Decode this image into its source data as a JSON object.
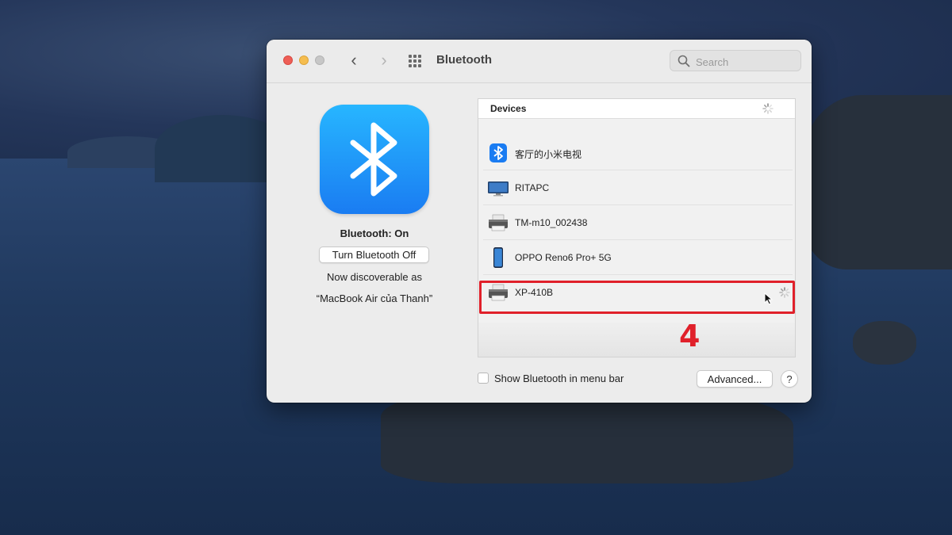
{
  "window": {
    "title": "Bluetooth",
    "search": {
      "placeholder": "Search",
      "value": ""
    }
  },
  "bluetooth": {
    "status": "Bluetooth: On",
    "toggle_label": "Turn Bluetooth Off",
    "discoverable_line1": "Now discoverable as",
    "discoverable_line2": "“MacBook Air của Thanh”"
  },
  "devices": {
    "header": "Devices",
    "items": [
      {
        "name": "客厅的小米电视",
        "icon": "bluetooth-device-icon"
      },
      {
        "name": "RITAPC",
        "icon": "desktop-monitor-icon"
      },
      {
        "name": "TM-m10_002438",
        "icon": "printer-icon"
      },
      {
        "name": "OPPO Reno6 Pro+ 5G",
        "icon": "phone-icon"
      },
      {
        "name": "XP-410B",
        "icon": "printer-icon",
        "connecting": true
      }
    ]
  },
  "annotation": {
    "step": "4",
    "color": "#e0202a"
  },
  "footer": {
    "show_in_menu_bar_label": "Show Bluetooth in menu bar",
    "show_in_menu_bar_checked": false,
    "advanced_label": "Advanced...",
    "help_label": "?"
  },
  "colors": {
    "bluetooth_blue": "#1a7cf2",
    "highlight_red": "#e0202a"
  }
}
